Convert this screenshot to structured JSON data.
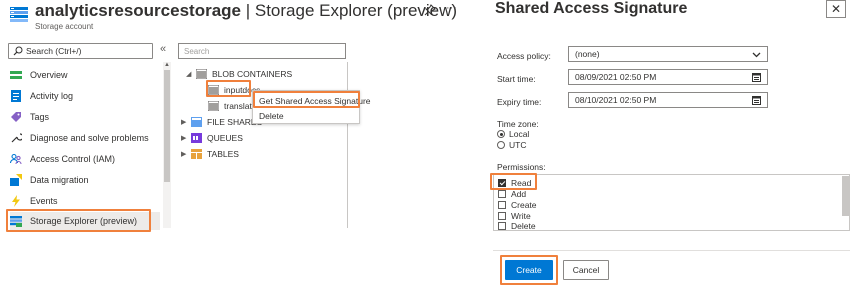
{
  "header": {
    "title_bold": "analyticsresourcestorage",
    "title_sep": " | ",
    "title_rest": "Storage Explorer (preview)",
    "subtitle": "Storage account",
    "more_label": "···"
  },
  "nav": {
    "search_placeholder": "Search (Ctrl+/)",
    "collapse_label": "«",
    "items": [
      {
        "label": "Overview",
        "icon": "overview-icon"
      },
      {
        "label": "Activity log",
        "icon": "activity-log-icon"
      },
      {
        "label": "Tags",
        "icon": "tag-icon"
      },
      {
        "label": "Diagnose and solve problems",
        "icon": "wrench-icon"
      },
      {
        "label": "Access Control (IAM)",
        "icon": "people-icon"
      },
      {
        "label": "Data migration",
        "icon": "data-migration-icon"
      },
      {
        "label": "Events",
        "icon": "lightning-icon"
      },
      {
        "label": "Storage Explorer (preview)",
        "icon": "storage-explorer-icon",
        "selected": true
      }
    ]
  },
  "tree": {
    "search_placeholder": "Search",
    "nodes": [
      {
        "label": "BLOB CONTAINERS",
        "expanded": true
      },
      {
        "label": "inputdocs"
      },
      {
        "label": "translated"
      },
      {
        "label": "FILE SHARES"
      },
      {
        "label": "QUEUES"
      },
      {
        "label": "TABLES"
      }
    ]
  },
  "context_menu": {
    "items": [
      "Get Shared Access Signature",
      "Delete"
    ]
  },
  "sas": {
    "title": "Shared Access Signature",
    "close_label": "✕",
    "access_policy_label": "Access policy:",
    "access_policy_value": "(none)",
    "start_time_label": "Start time:",
    "start_time_value": "08/09/2021 02:50 PM",
    "expiry_time_label": "Expiry time:",
    "expiry_time_value": "08/10/2021 02:50 PM",
    "time_zone_label": "Time zone:",
    "time_zone_options": [
      "Local",
      "UTC"
    ],
    "time_zone_selected": "Local",
    "permissions_label": "Permissions:",
    "permissions": [
      {
        "label": "Read",
        "checked": true
      },
      {
        "label": "Add",
        "checked": false
      },
      {
        "label": "Create",
        "checked": false
      },
      {
        "label": "Write",
        "checked": false
      },
      {
        "label": "Delete",
        "checked": false
      }
    ],
    "create_label": "Create",
    "cancel_label": "Cancel"
  },
  "colors": {
    "accent": "#0078d4",
    "highlight": "#f0803c"
  }
}
